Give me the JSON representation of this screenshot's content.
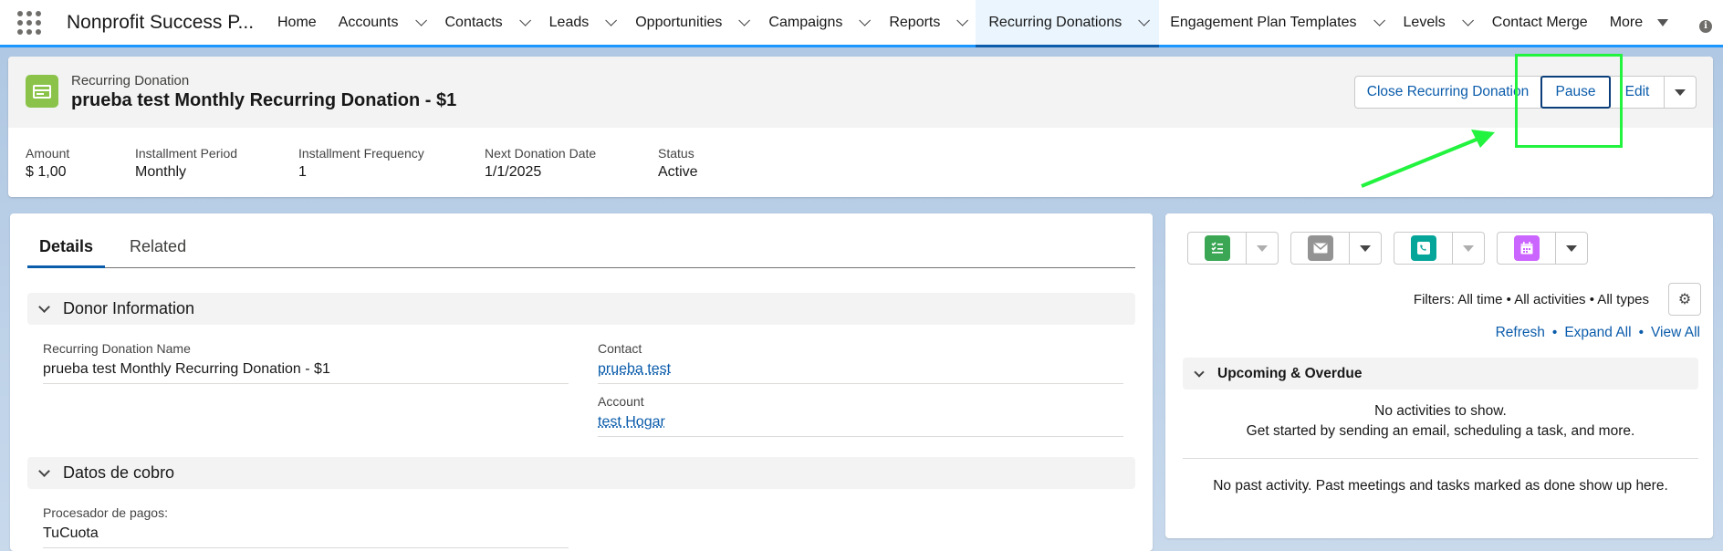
{
  "app": {
    "name": "Nonprofit Success P...",
    "nav": [
      {
        "label": "Home",
        "has_menu": false
      },
      {
        "label": "Accounts",
        "has_menu": true
      },
      {
        "label": "Contacts",
        "has_menu": true
      },
      {
        "label": "Leads",
        "has_menu": true
      },
      {
        "label": "Opportunities",
        "has_menu": true
      },
      {
        "label": "Campaigns",
        "has_menu": true
      },
      {
        "label": "Reports",
        "has_menu": true
      },
      {
        "label": "Recurring Donations",
        "has_menu": true,
        "active": true
      },
      {
        "label": "Engagement Plan Templates",
        "has_menu": true
      },
      {
        "label": "Levels",
        "has_menu": true
      },
      {
        "label": "Contact Merge",
        "has_menu": false
      },
      {
        "label": "More",
        "has_menu": true
      }
    ],
    "info_icon": "i"
  },
  "record": {
    "object_label": "Recurring Donation",
    "title": "prueba test Monthly Recurring Donation - $1",
    "icon": "credit-card-icon",
    "icon_color": "#8bc34a",
    "actions": {
      "close": "Close Recurring Donation",
      "pause": "Pause",
      "edit": "Edit"
    },
    "highlights": [
      {
        "label": "Amount",
        "value": "$ 1,00"
      },
      {
        "label": "Installment Period",
        "value": "Monthly"
      },
      {
        "label": "Installment Frequency",
        "value": "1"
      },
      {
        "label": "Next Donation Date",
        "value": "1/1/2025"
      },
      {
        "label": "Status",
        "value": "Active"
      }
    ]
  },
  "tabs": {
    "details": "Details",
    "related": "Related"
  },
  "sections": {
    "donor": {
      "title": "Donor Information",
      "rd_name_label": "Recurring Donation Name",
      "rd_name_value": "prueba test Monthly Recurring Donation - $1",
      "contact_label": "Contact",
      "contact_value": "prueba test",
      "account_label": "Account",
      "account_value": "test Hogar"
    },
    "billing": {
      "title": "Datos de cobro",
      "processor_label": "Procesador de pagos:",
      "processor_value": "TuCuota"
    }
  },
  "activity": {
    "buttons": [
      {
        "icon": "new-task-icon",
        "color": "#3ba755"
      },
      {
        "icon": "email-icon",
        "color": "#939393"
      },
      {
        "icon": "log-call-icon",
        "color": "#06a59a"
      },
      {
        "icon": "new-event-icon",
        "color": "#cb65ff"
      }
    ],
    "filters": "Filters: All time • All activities • All types",
    "refresh": "Refresh",
    "expand_all": "Expand All",
    "view_all": "View All",
    "upcoming_title": "Upcoming & Overdue",
    "no_activities": "No activities to show.",
    "get_started": "Get started by sending an email, scheduling a task, and more.",
    "no_past": "No past activity. Past meetings and tasks marked as done show up here."
  },
  "colors": {
    "brand": "#0b5cab",
    "annotation": "#22f33e",
    "nav_active_bg": "#eaf5fe"
  }
}
